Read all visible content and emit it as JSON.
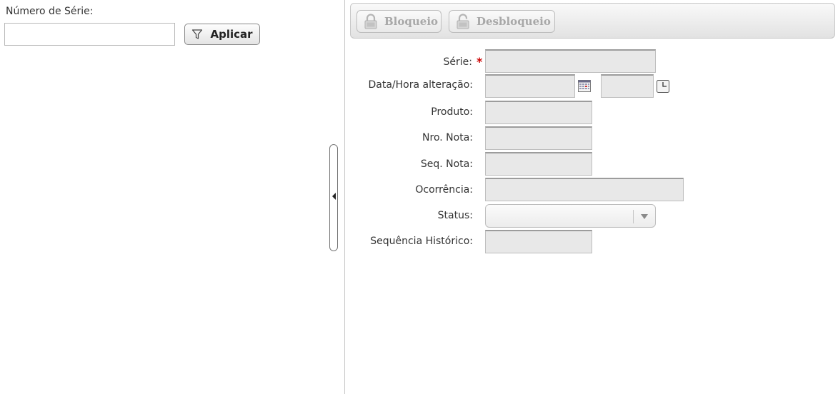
{
  "filter": {
    "label": "Número de Série:",
    "input_value": "",
    "apply_label": "Aplicar",
    "apply_icon": "filter-icon"
  },
  "toolbar": {
    "lock_label": "Bloqueio",
    "lock_icon": "padlock-icon",
    "unlock_label": "Desbloqueio",
    "unlock_icon": "padlock-open-icon",
    "disabled_text_color": "#a8a8a8"
  },
  "form": {
    "serie_label": "Série:",
    "required_marker": "*",
    "datetime_label": "Data/Hora alteração:",
    "produto_label": "Produto:",
    "nro_nota_label": "Nro. Nota:",
    "seq_nota_label": "Seq. Nota:",
    "ocorrencia_label": "Ocorrência:",
    "status_label": "Status:",
    "seq_historico_label": "Sequência Histórico:",
    "serie_value": "",
    "date_value": "",
    "time_value": "",
    "produto_value": "",
    "nro_nota_value": "",
    "seq_nota_value": "",
    "ocorrencia_value": "",
    "status_value": "",
    "seq_historico_value": "",
    "calendar_icon": "calendar-icon",
    "clock_icon": "clock-icon"
  },
  "colors": {
    "required": "#cc0000",
    "field_background": "#e8e8e8"
  }
}
